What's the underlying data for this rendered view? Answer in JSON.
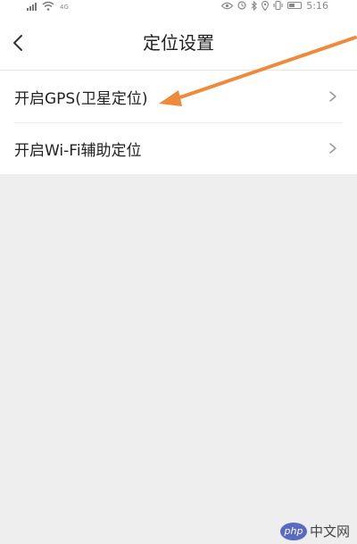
{
  "status_bar": {
    "network_label": "4G",
    "time": "5:16",
    "icons": [
      "signal-icon",
      "wifi-icon",
      "eye-icon",
      "alarm-icon",
      "bluetooth-icon",
      "location-icon",
      "vibrate-icon",
      "battery-icon"
    ]
  },
  "header": {
    "title": "定位设置",
    "back_icon": "chevron-left-icon"
  },
  "settings": {
    "items": [
      {
        "label": "开启GPS(卫星定位)",
        "icon": "chevron-right-icon"
      },
      {
        "label": "开启Wi-Fi辅助定位",
        "icon": "chevron-right-icon"
      }
    ]
  },
  "annotation": {
    "color": "#ee8a3c",
    "points_to": "开启GPS(卫星定位)"
  },
  "watermark": {
    "badge": "php",
    "text": "中文网"
  },
  "colors": {
    "background": "#eeeeee",
    "surface": "#ffffff",
    "text": "#222222",
    "chevron": "#999999"
  }
}
